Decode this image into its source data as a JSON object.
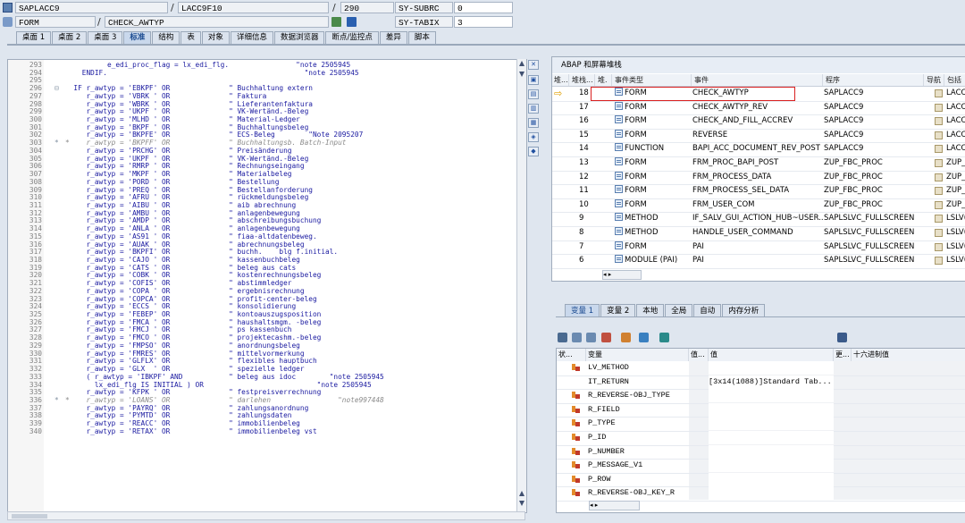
{
  "header": {
    "program": "SAPLACC9",
    "include": "LACC9F10",
    "line_no": "290",
    "sy1_label": "SY-SUBRC",
    "sy1_val": "0",
    "event_type": "FORM",
    "event": "CHECK_AWTYP",
    "sy2_label": "SY-TABIX",
    "sy2_val": "3"
  },
  "tabs": [
    "桌面 1",
    "桌面 2",
    "桌面 3",
    "标准",
    "结构",
    "表",
    "对象",
    "详细信息",
    "数据浏览器",
    "断点/监控点",
    "差异",
    "脚本"
  ],
  "code_lines": [
    {
      "n": "293",
      "m": "",
      "t": "          e_edi_proc_flag = lx_edi_flg.                \"note 2505945"
    },
    {
      "n": "294",
      "m": "",
      "t": "    ENDIF.                                               \"note 2505945"
    },
    {
      "n": "295",
      "m": "",
      "t": ""
    },
    {
      "n": "296",
      "m": "⊟",
      "t": "  IF r_awtyp = 'EBKPF' OR              \" Buchhaltung extern"
    },
    {
      "n": "297",
      "m": "",
      "t": "     r_awtyp = 'VBRK ' OR              \" Faktura"
    },
    {
      "n": "298",
      "m": "",
      "t": "     r_awtyp = 'WBRK ' OR              \" Lieferantenfaktura"
    },
    {
      "n": "299",
      "m": "",
      "t": "     r_awtyp = 'UKPF ' OR              \" VK-Wertänd.-Beleg"
    },
    {
      "n": "300",
      "m": "",
      "t": "     r_awtyp = 'MLHD ' OR              \" Material-Ledger"
    },
    {
      "n": "301",
      "m": "",
      "t": "     r_awtyp = 'BKPF ' OR              \" Buchhaltungsbeleg"
    },
    {
      "n": "302",
      "m": "",
      "t": "     r_awtyp = 'BKPFE' OR              \" ECS-Beleg        \"Note 2095207"
    },
    {
      "n": "303",
      "m": "*",
      "t": "*    r_awtyp = 'BKPFF' OR              \" Buchhaltungsb. Batch-Input"
    },
    {
      "n": "304",
      "m": "",
      "t": "     r_awtyp = 'PRCHG' OR              \" Preisänderung"
    },
    {
      "n": "305",
      "m": "",
      "t": "     r_awtyp = 'UKPF ' OR              \" VK-Wertänd.-Beleg"
    },
    {
      "n": "306",
      "m": "",
      "t": "     r_awtyp = 'RMRP ' OR              \" Rechnungseingang"
    },
    {
      "n": "307",
      "m": "",
      "t": "     r_awtyp = 'MKPF ' OR              \" Materialbeleg"
    },
    {
      "n": "308",
      "m": "",
      "t": "     r_awtyp = 'PORD ' OR              \" Bestellung"
    },
    {
      "n": "309",
      "m": "",
      "t": "     r_awtyp = 'PREQ ' OR              \" Bestellanforderung"
    },
    {
      "n": "310",
      "m": "",
      "t": "     r_awtyp = 'AFRU ' OR              \" rückmeldungsbeleg"
    },
    {
      "n": "311",
      "m": "",
      "t": "     r_awtyp = 'AIBU ' OR              \" aib abrechnung"
    },
    {
      "n": "312",
      "m": "",
      "t": "     r_awtyp = 'AMBU ' OR              \" anlagenbewegung"
    },
    {
      "n": "313",
      "m": "",
      "t": "     r_awtyp = 'AMDP ' OR              \" abschreibungsbuchung"
    },
    {
      "n": "314",
      "m": "",
      "t": "     r_awtyp = 'ANLA ' OR              \" anlagenbewegung"
    },
    {
      "n": "315",
      "m": "",
      "t": "     r_awtyp = 'AS91 ' OR              \" fiaa-altdatenbeweg."
    },
    {
      "n": "316",
      "m": "",
      "t": "     r_awtyp = 'AUAK ' OR              \" abrechnungsbeleg"
    },
    {
      "n": "317",
      "m": "",
      "t": "     r_awtyp = 'BKPFI' OR              \" buchh.    blg f.initial."
    },
    {
      "n": "318",
      "m": "",
      "t": "     r_awtyp = 'CAJO ' OR              \" kassenbuchbeleg"
    },
    {
      "n": "319",
      "m": "",
      "t": "     r_awtyp = 'CATS ' OR              \" beleg aus cats"
    },
    {
      "n": "320",
      "m": "",
      "t": "     r_awtyp = 'COBK ' OR              \" kostenrechnungsbeleg"
    },
    {
      "n": "321",
      "m": "",
      "t": "     r_awtyp = 'COFIS' OR              \" abstimmledger"
    },
    {
      "n": "322",
      "m": "",
      "t": "     r_awtyp = 'COPA ' OR              \" ergebnisrechnung"
    },
    {
      "n": "323",
      "m": "",
      "t": "     r_awtyp = 'COPCA' OR              \" profit-center-beleg"
    },
    {
      "n": "324",
      "m": "",
      "t": "     r_awtyp = 'ECCS ' OR              \" konsolidierung"
    },
    {
      "n": "325",
      "m": "",
      "t": "     r_awtyp = 'FEBEP' OR              \" kontoauszugsposition"
    },
    {
      "n": "326",
      "m": "",
      "t": "     r_awtyp = 'FMCA ' OR              \" haushaltsmgm. -beleg"
    },
    {
      "n": "327",
      "m": "",
      "t": "     r_awtyp = 'FMCJ ' OR              \" ps kassenbuch"
    },
    {
      "n": "328",
      "m": "",
      "t": "     r_awtyp = 'FMCO ' OR              \" projektecashm.-beleg"
    },
    {
      "n": "329",
      "m": "",
      "t": "     r_awtyp = 'FMPSO' OR              \" anordnungsbeleg"
    },
    {
      "n": "330",
      "m": "",
      "t": "     r_awtyp = 'FMRES' OR              \" mittelvormerkung"
    },
    {
      "n": "331",
      "m": "",
      "t": "     r_awtyp = 'GLFLX' OR              \" flexibles hauptbuch"
    },
    {
      "n": "332",
      "m": "",
      "t": "     r_awtyp = 'GLX  ' OR              \" spezielle ledger"
    },
    {
      "n": "333",
      "m": "",
      "t": "     ( r_awtyp = 'IBKPF' AND           \" beleg aus idoc        \"note 2505945"
    },
    {
      "n": "334",
      "m": "",
      "t": "       lx_edi_flg IS INITIAL ) OR                           \"note 2505945"
    },
    {
      "n": "335",
      "m": "",
      "t": "     r_awtyp = 'KFPK ' OR              \" festpreisverrechnung"
    },
    {
      "n": "336",
      "m": "*",
      "t": "*    r_awtyp = 'LOANS' OR              \" darlehen                \"note997448"
    },
    {
      "n": "337",
      "m": "",
      "t": "     r_awtyp = 'PAYRQ' OR              \" zahlungsanordnung"
    },
    {
      "n": "338",
      "m": "",
      "t": "     r_awtyp = 'PYMTD' OR              \" zahlungsdaten"
    },
    {
      "n": "339",
      "m": "",
      "t": "     r_awtyp = 'REACC' OR              \" immobilienbeleg"
    },
    {
      "n": "340",
      "m": "",
      "t": "     r_awtyp = 'RETAX' OR              \" immobilienbeleg vst"
    }
  ],
  "stack": {
    "title": "ABAP 和屏幕堆栈",
    "headers": [
      "堆...",
      "堆栈...",
      "堆.",
      "事件类型",
      "事件",
      "程序",
      "导航",
      "包括"
    ],
    "rows": [
      {
        "level": "18",
        "type": "FORM",
        "event": "CHECK_AWTYP",
        "program": "SAPLACC9",
        "include": "LACC",
        "current": true
      },
      {
        "level": "17",
        "type": "FORM",
        "event": "CHECK_AWTYP_REV",
        "program": "SAPLACC9",
        "include": "LACC"
      },
      {
        "level": "16",
        "type": "FORM",
        "event": "CHECK_AND_FILL_ACCREV",
        "program": "SAPLACC9",
        "include": "LACC"
      },
      {
        "level": "15",
        "type": "FORM",
        "event": "REVERSE",
        "program": "SAPLACC9",
        "include": "LACC"
      },
      {
        "level": "14",
        "type": "FUNCTION",
        "event": "BAPI_ACC_DOCUMENT_REV_POST",
        "program": "SAPLACC9",
        "include": "LACC"
      },
      {
        "level": "13",
        "type": "FORM",
        "event": "FRM_PROC_BAPI_POST",
        "program": "ZUP_FBC_PROC",
        "include": "ZUP_"
      },
      {
        "level": "12",
        "type": "FORM",
        "event": "FRM_PROCESS_DATA",
        "program": "ZUP_FBC_PROC",
        "include": "ZUP_"
      },
      {
        "level": "11",
        "type": "FORM",
        "event": "FRM_PROCESS_SEL_DATA",
        "program": "ZUP_FBC_PROC",
        "include": "ZUP_"
      },
      {
        "level": "10",
        "type": "FORM",
        "event": "FRM_USER_COM",
        "program": "ZUP_FBC_PROC",
        "include": "ZUP_"
      },
      {
        "level": "9",
        "type": "METHOD",
        "event": "IF_SALV_GUI_ACTION_HUB~USER...",
        "program": "SAPLSLVC_FULLSCREEN",
        "include": "LSLV("
      },
      {
        "level": "8",
        "type": "METHOD",
        "event": "HANDLE_USER_COMMAND",
        "program": "SAPLSLVC_FULLSCREEN",
        "include": "LSLV("
      },
      {
        "level": "7",
        "type": "FORM",
        "event": "PAI",
        "program": "SAPLSLVC_FULLSCREEN",
        "include": "LSLV("
      },
      {
        "level": "6",
        "type": "MODULE (PAI)",
        "event": "PAI",
        "program": "SAPLSLVC_FULLSCREEN",
        "include": "LSLV("
      }
    ]
  },
  "var_tabs": [
    "变量 1",
    "变量 2",
    "本地",
    "全局",
    "自动",
    "内存分析"
  ],
  "vars": {
    "headers": [
      "状...",
      "变量",
      "值...",
      "值",
      "更...",
      "十六进制值"
    ],
    "rows": [
      {
        "name": "LV_METHOD",
        "value": "",
        "icon": true
      },
      {
        "name": "IT_RETURN",
        "value": "[3x14(1088)]Standard Tab...",
        "icon": false
      },
      {
        "name": "R_REVERSE-OBJ_TYPE",
        "value": "",
        "icon": true
      },
      {
        "name": "R_FIELD",
        "value": "",
        "icon": true
      },
      {
        "name": "P_TYPE",
        "value": "",
        "icon": true
      },
      {
        "name": "P_ID",
        "value": "",
        "icon": true
      },
      {
        "name": "P_NUMBER",
        "value": "",
        "icon": true
      },
      {
        "name": "P_MESSAGE_V1",
        "value": "",
        "icon": true
      },
      {
        "name": "P_ROW",
        "value": "",
        "icon": true
      },
      {
        "name": "R_REVERSE-OBJ_KEY_R",
        "value": "",
        "icon": true
      }
    ]
  },
  "colors": {
    "accent": "#1a4a90",
    "highlight_border": "#d92020",
    "string": "#2e8b57",
    "keyword": "#1a1aa0",
    "comment": "#8a8a8a"
  }
}
